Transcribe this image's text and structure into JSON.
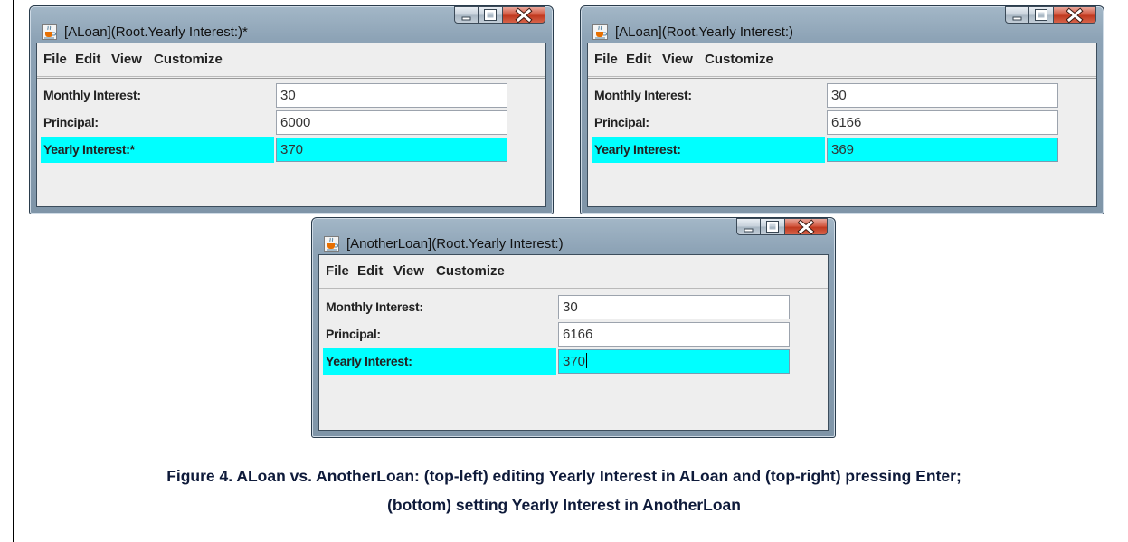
{
  "windows": [
    {
      "id": "aloan-editing",
      "title": "[ALoan](Root.Yearly Interest:)*",
      "menu": [
        "File",
        "Edit",
        "View",
        "Customize"
      ],
      "fields": [
        {
          "label": "Monthly Interest:",
          "value": "30",
          "highlighted": false
        },
        {
          "label": "Principal:",
          "value": "6000",
          "highlighted": false
        },
        {
          "label": "Yearly Interest:*",
          "value": "370",
          "highlighted": true
        }
      ]
    },
    {
      "id": "aloan-enter",
      "title": "[ALoan](Root.Yearly Interest:)",
      "menu": [
        "File",
        "Edit",
        "View",
        "Customize"
      ],
      "fields": [
        {
          "label": "Monthly Interest:",
          "value": "30",
          "highlighted": false
        },
        {
          "label": "Principal:",
          "value": "6166",
          "highlighted": false
        },
        {
          "label": "Yearly Interest:",
          "value": "369",
          "highlighted": true
        }
      ]
    },
    {
      "id": "anotherloan",
      "title": "[AnotherLoan](Root.Yearly Interest:)",
      "menu": [
        "File",
        "Edit",
        "View",
        "Customize"
      ],
      "fields": [
        {
          "label": "Monthly Interest:",
          "value": "30",
          "highlighted": false
        },
        {
          "label": "Principal:",
          "value": "6166",
          "highlighted": false
        },
        {
          "label": "Yearly Interest:",
          "value": "370",
          "highlighted": true
        }
      ]
    }
  ],
  "caption": {
    "line1": "Figure 4. ALoan vs. AnotherLoan: (top-left) editing Yearly Interest in ALoan and (top-right) pressing Enter;",
    "line2": "(bottom) setting Yearly Interest in AnotherLoan"
  },
  "colors": {
    "highlight": "#00ffff",
    "client_background": "#eeeeee",
    "close_button": "#c7432b"
  },
  "icons": {
    "app": "java-cup-icon",
    "minimize": "minimize-icon",
    "maximize": "maximize-icon",
    "close": "close-icon"
  }
}
